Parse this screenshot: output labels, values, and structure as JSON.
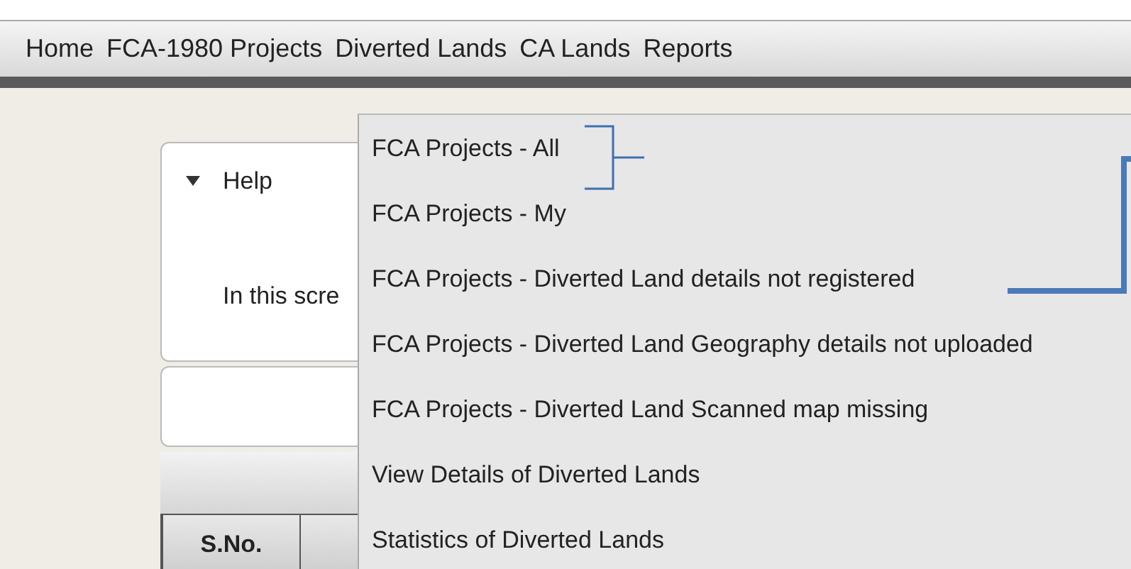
{
  "menu_bar": [
    {
      "label": "Home"
    },
    {
      "label": "FCA-1980 Projects"
    },
    {
      "label": "Diverted Lands"
    },
    {
      "label": "CA Lands"
    },
    {
      "label": "Reports"
    }
  ],
  "help_panel": {
    "title": "Help",
    "expanded": true,
    "text": "In this scre"
  },
  "table": {
    "columns": [
      "S.No."
    ]
  },
  "dropdown": {
    "items": [
      {
        "label": "FCA Projects - All"
      },
      {
        "label": "FCA Projects - My"
      },
      {
        "label": "FCA Projects - Diverted Land details not registered"
      },
      {
        "label": "FCA Projects - Diverted Land Geography details not uploaded"
      },
      {
        "label": "FCA Projects - Diverted Land Scanned map missing"
      },
      {
        "label": "View Details of Diverted Lands"
      },
      {
        "label": "Statistics of Diverted Lands"
      }
    ]
  }
}
